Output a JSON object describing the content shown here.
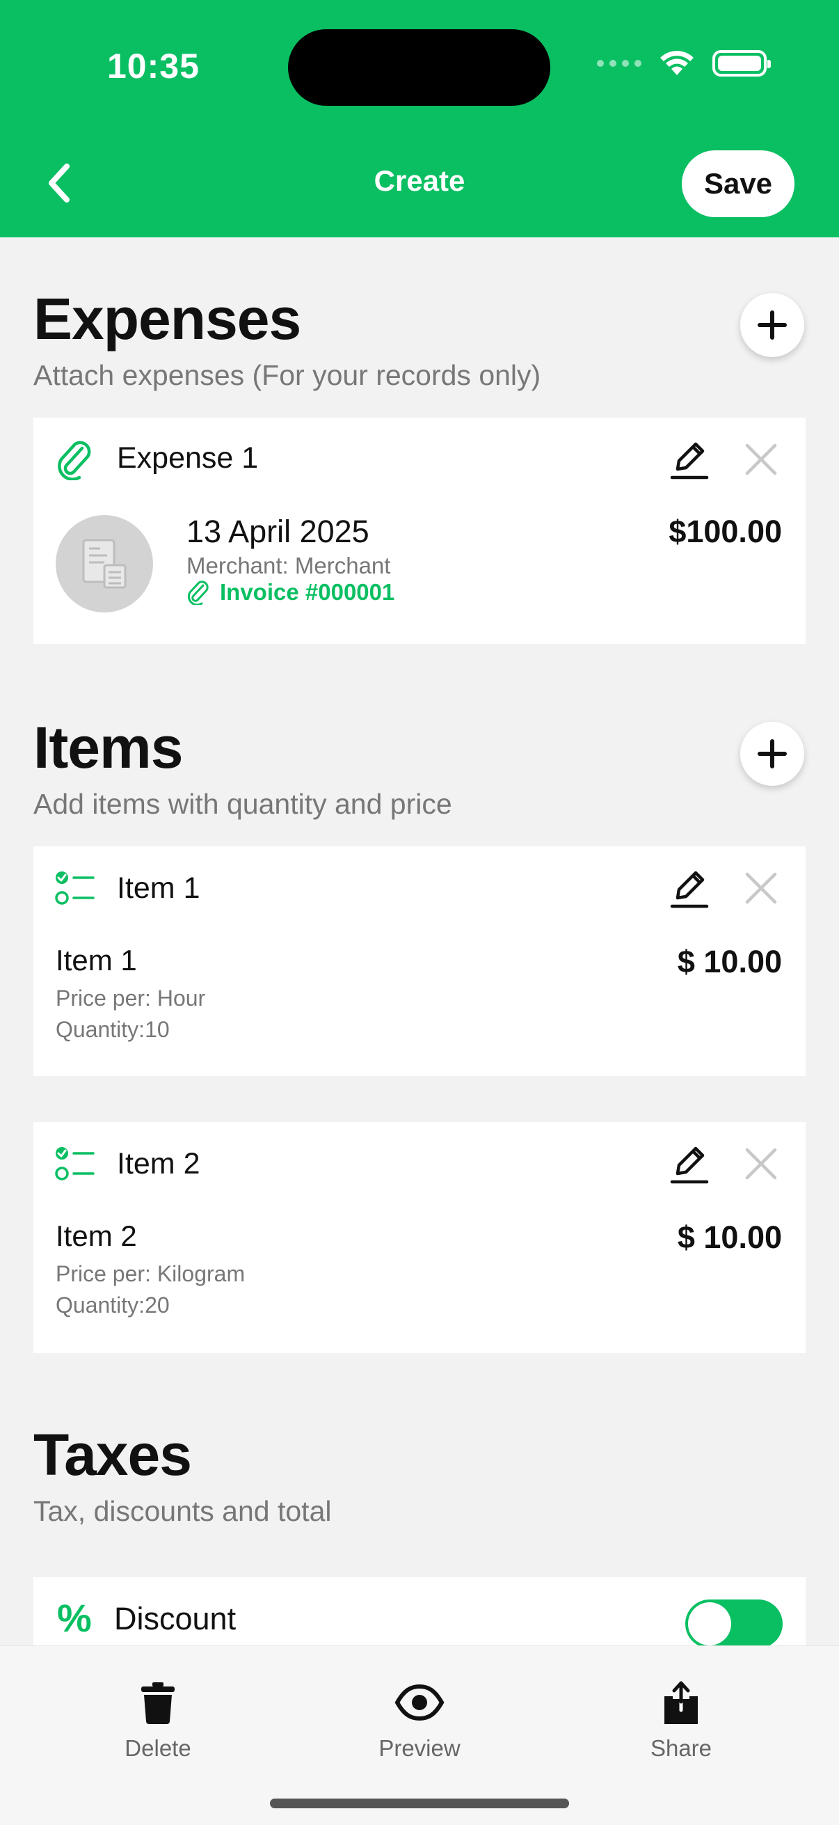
{
  "status_bar": {
    "time": "10:35"
  },
  "nav": {
    "title": "Create",
    "save_label": "Save"
  },
  "expenses_section": {
    "title": "Expenses",
    "subtitle": "Attach expenses (For your records only)",
    "cards": [
      {
        "title": "Expense 1",
        "date": "13 April 2025",
        "merchant": "Merchant: Merchant",
        "invoice": "Invoice #000001",
        "amount": "$100.00"
      }
    ]
  },
  "items_section": {
    "title": "Items",
    "subtitle": "Add items with quantity and price",
    "cards": [
      {
        "title": "Item 1",
        "name": "Item 1",
        "price_per": "Price per: Hour",
        "quantity": "Quantity:10",
        "amount": "$ 10.00"
      },
      {
        "title": "Item 2",
        "name": "Item 2",
        "price_per": "Price per: Kilogram",
        "quantity": "Quantity:20",
        "amount": "$ 10.00"
      }
    ]
  },
  "taxes_section": {
    "title": "Taxes",
    "subtitle": "Tax, discounts and total",
    "discount": {
      "label": "Discount",
      "enabled": true
    }
  },
  "tabbar": {
    "tabs": [
      {
        "label": "Delete",
        "icon": "trash-icon"
      },
      {
        "label": "Preview",
        "icon": "eye-icon"
      },
      {
        "label": "Share",
        "icon": "share-icon"
      }
    ]
  },
  "colors": {
    "accent": "#0abf62",
    "background": "#f2f2f2"
  }
}
